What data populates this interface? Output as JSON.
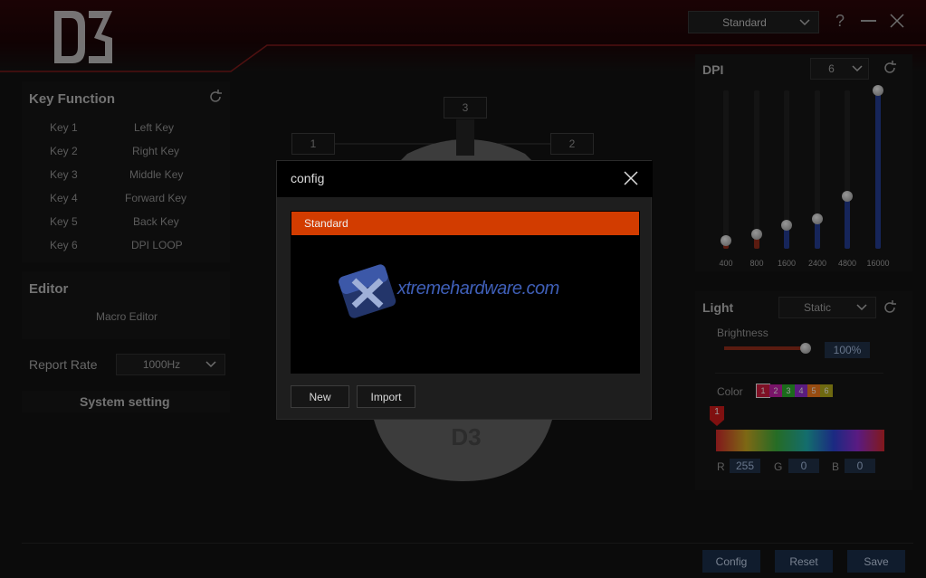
{
  "header": {
    "logo_text": "D3",
    "profile_select": "Standard",
    "help_label": "?"
  },
  "key_function": {
    "title": "Key Function",
    "rows": [
      {
        "key": "Key 1",
        "action": "Left Key"
      },
      {
        "key": "Key 2",
        "action": "Right Key"
      },
      {
        "key": "Key 3",
        "action": "Middle Key"
      },
      {
        "key": "Key 4",
        "action": "Forward Key"
      },
      {
        "key": "Key 5",
        "action": "Back Key"
      },
      {
        "key": "Key 6",
        "action": "DPI LOOP"
      }
    ]
  },
  "editor": {
    "title": "Editor",
    "macro_label": "Macro Editor",
    "report_rate_label": "Report Rate",
    "report_rate_value": "1000Hz",
    "system_setting_label": "System setting"
  },
  "mouse": {
    "labels": [
      "3",
      "1",
      "2"
    ],
    "logo_text": "D3"
  },
  "modal": {
    "title": "config",
    "items": [
      "Standard"
    ],
    "watermark": "xtremehardware.com",
    "new_label": "New",
    "import_label": "Import"
  },
  "dpi": {
    "title": "DPI",
    "stage_select": "6",
    "stages": [
      {
        "label": "400",
        "level": 0.05,
        "active": false
      },
      {
        "label": "800",
        "level": 0.09,
        "active": false
      },
      {
        "label": "1600",
        "level": 0.15,
        "active": true
      },
      {
        "label": "2400",
        "level": 0.19,
        "active": true
      },
      {
        "label": "4800",
        "level": 0.33,
        "active": true
      },
      {
        "label": "16000",
        "level": 1.0,
        "active": true
      }
    ]
  },
  "light": {
    "title": "Light",
    "mode_select": "Static",
    "brightness_label": "Brightness",
    "brightness_value": "100%",
    "brightness_level": 1.0,
    "color_label": "Color",
    "swatches": [
      {
        "label": "1",
        "color": "#c21a3a"
      },
      {
        "label": "2",
        "color": "#b81fa0"
      },
      {
        "label": "3",
        "color": "#2aa52a"
      },
      {
        "label": "4",
        "color": "#8d2cc4"
      },
      {
        "label": "5",
        "color": "#e8751b"
      },
      {
        "label": "6",
        "color": "#a9a21a"
      }
    ],
    "marker_label": "1",
    "r_label": "R",
    "r_value": "255",
    "g_label": "G",
    "g_value": "0",
    "b_label": "B",
    "b_value": "0"
  },
  "footer": {
    "config_label": "Config",
    "reset_label": "Reset",
    "save_label": "Save"
  },
  "colors": {
    "accent": "#d23c00",
    "button_blue": "#1a2c46",
    "dpi_blue": "#233a8a",
    "dpi_red": "#8a2a1a"
  }
}
